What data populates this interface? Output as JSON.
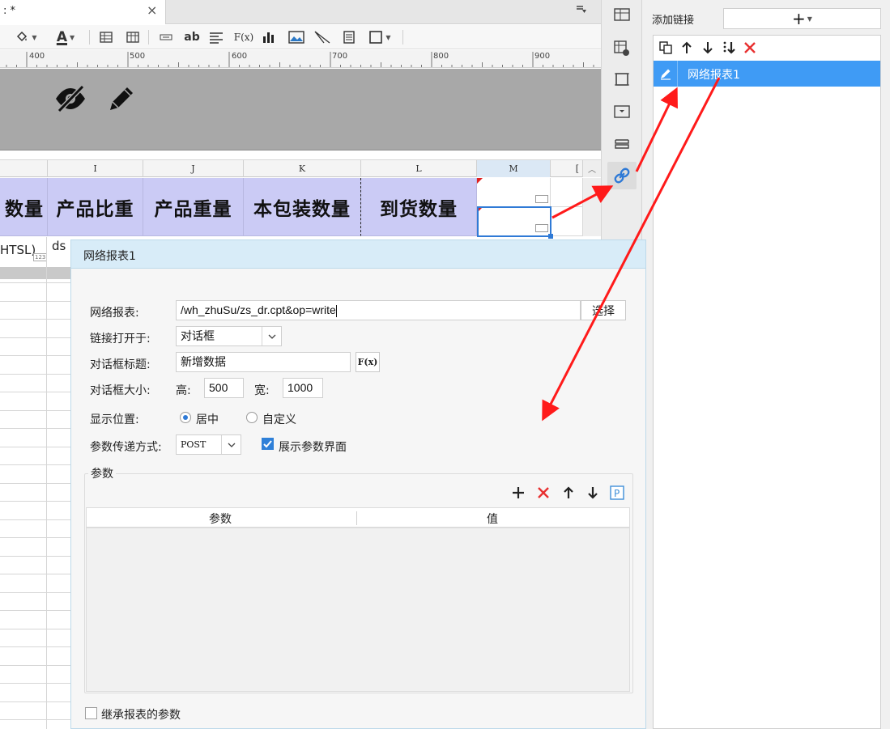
{
  "tab": {
    "title": ": *",
    "close": "×"
  },
  "ruler": {
    "labels": [
      "400",
      "500",
      "600",
      "700",
      "800",
      "900"
    ]
  },
  "columns": [
    "I",
    "J",
    "K",
    "L",
    "M",
    "["
  ],
  "header_cells": [
    "数量",
    "产品比重",
    "产品重量",
    "本包装数量",
    "到货数量"
  ],
  "left_grid": {
    "text1": "HTSL)",
    "text2": "ds",
    "tiny_label": "123"
  },
  "toolbar": {
    "font_color_label": "A",
    "text_label": "ab",
    "fx_label": "F(x)"
  },
  "right_panel": {
    "add_link_label": "添加链接",
    "add_button": "+",
    "items": [
      {
        "name": "网络报表1",
        "selected": true
      }
    ]
  },
  "dialog": {
    "title": "网络报表1",
    "report_label": "网络报表:",
    "report_value": "/wh_zhuSu/zs_dr.cpt&op=write",
    "select_button": "选择",
    "open_in_label": "链接打开于:",
    "open_in_value": "对话框",
    "dialog_title_label": "对话框标题:",
    "dialog_title_value": "新增数据",
    "fx_button": "F(x)",
    "dialog_size_label": "对话框大小:",
    "height_label": "高:",
    "height_value": "500",
    "width_label": "宽:",
    "width_value": "1000",
    "position_label": "显示位置:",
    "position_center": "居中",
    "position_custom": "自定义",
    "param_method_label": "参数传递方式:",
    "param_method_value": "POST",
    "show_param_ui_label": "展示参数界面",
    "show_param_ui_checked": true,
    "params_group_label": "参数",
    "param_col": "参数",
    "value_col": "值",
    "inherit_label": "继承报表的参数",
    "inherit_checked": false
  },
  "colors": {
    "accent": "#3f9bf5",
    "header_purple": "#cbcbf5",
    "arrow_red": "#ff1a1a",
    "delete_red": "#e83030"
  }
}
